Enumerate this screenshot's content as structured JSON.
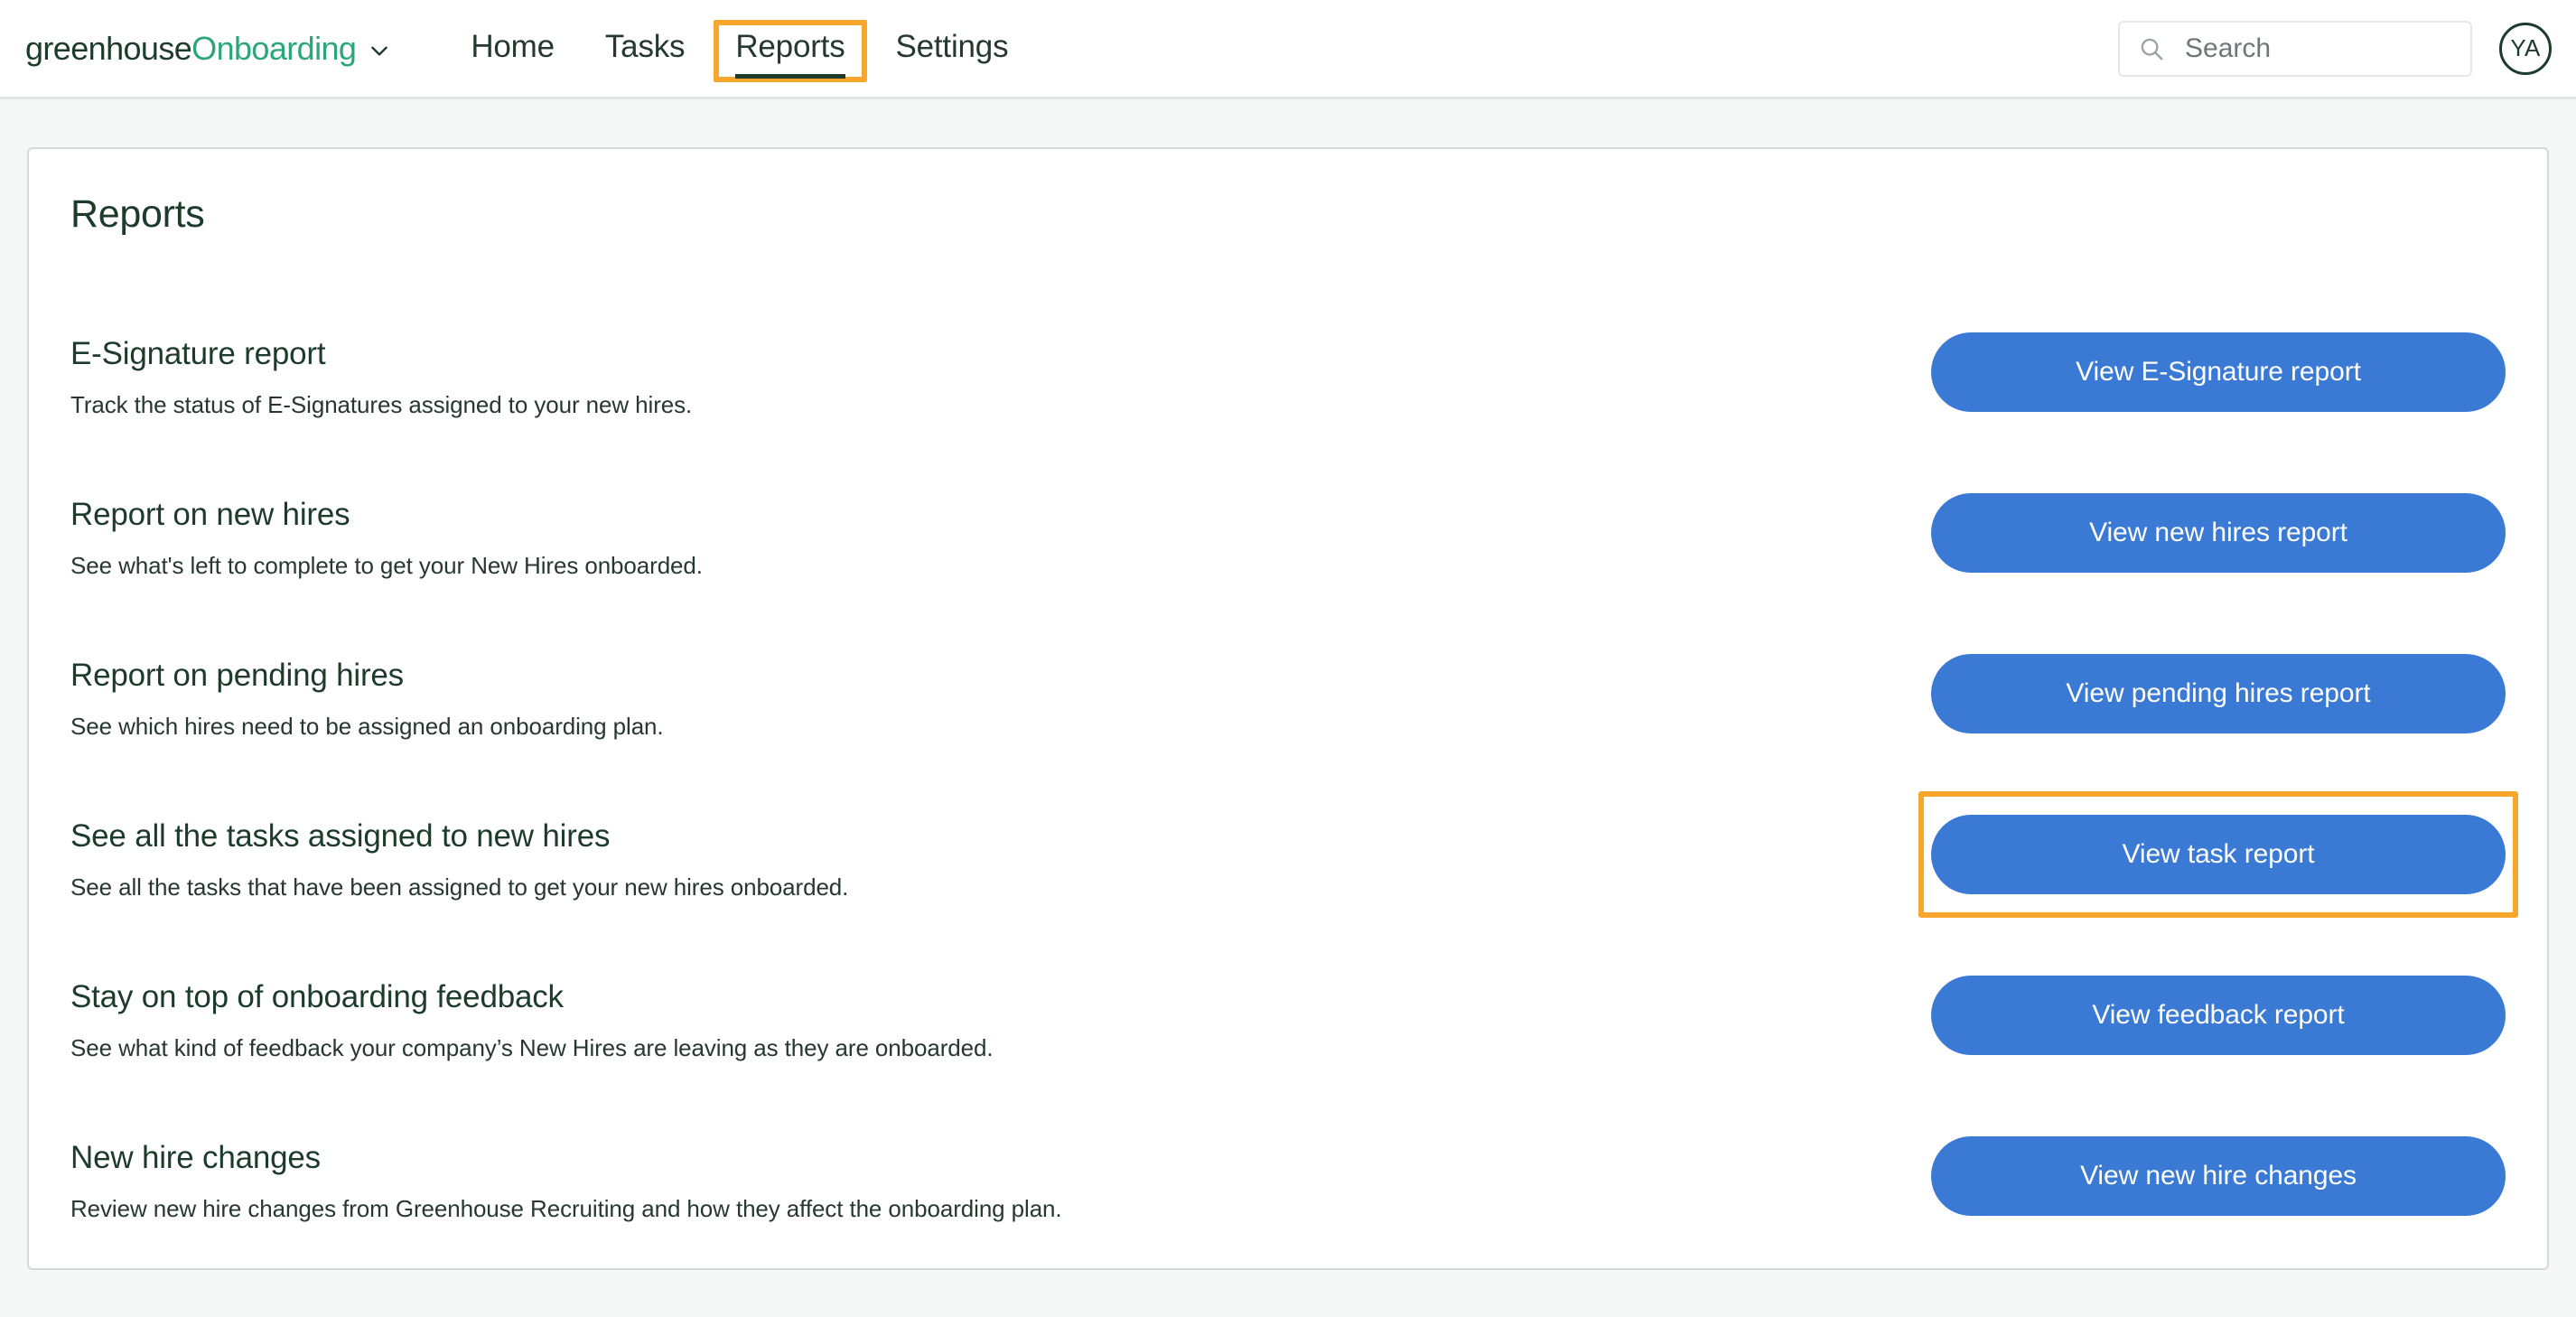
{
  "header": {
    "brand": {
      "company": "greenhouse",
      "product": "Onboarding",
      "chevron_icon": "chevron-down-icon"
    },
    "nav": [
      {
        "label": "Home",
        "active": false,
        "highlighted": false
      },
      {
        "label": "Tasks",
        "active": false,
        "highlighted": false
      },
      {
        "label": "Reports",
        "active": true,
        "highlighted": true
      },
      {
        "label": "Settings",
        "active": false,
        "highlighted": false
      }
    ],
    "search": {
      "icon": "search-icon",
      "placeholder": "Search",
      "value": ""
    },
    "avatar": {
      "initials": "YA"
    }
  },
  "main": {
    "page_title": "Reports",
    "reports": [
      {
        "title": "E-Signature report",
        "description": "Track the status of E-Signatures assigned to your new hires.",
        "button_label": "View E-Signature report",
        "highlighted": false
      },
      {
        "title": "Report on new hires",
        "description": "See what's left to complete to get your New Hires onboarded.",
        "button_label": "View new hires report",
        "highlighted": false
      },
      {
        "title": "Report on pending hires",
        "description": "See which hires need to be assigned an onboarding plan.",
        "button_label": "View pending hires report",
        "highlighted": false
      },
      {
        "title": "See all the tasks assigned to new hires",
        "description": "See all the tasks that have been assigned to get your new hires onboarded.",
        "button_label": "View task report",
        "highlighted": true
      },
      {
        "title": "Stay on top of onboarding feedback",
        "description": "See what kind of feedback your company’s New Hires are leaving as they are onboarded.",
        "button_label": "View feedback report",
        "highlighted": false
      },
      {
        "title": "New hire changes",
        "description": "Review new hire changes from Greenhouse Recruiting and how they affect the onboarding plan.",
        "button_label": "View new hire changes",
        "highlighted": false
      }
    ]
  },
  "colors": {
    "brand_green": "#2ba678",
    "dark_green": "#1d3b2a",
    "button_blue": "#3a79d4",
    "highlight_orange": "#f7a72c",
    "page_background": "#f6f7f7"
  }
}
